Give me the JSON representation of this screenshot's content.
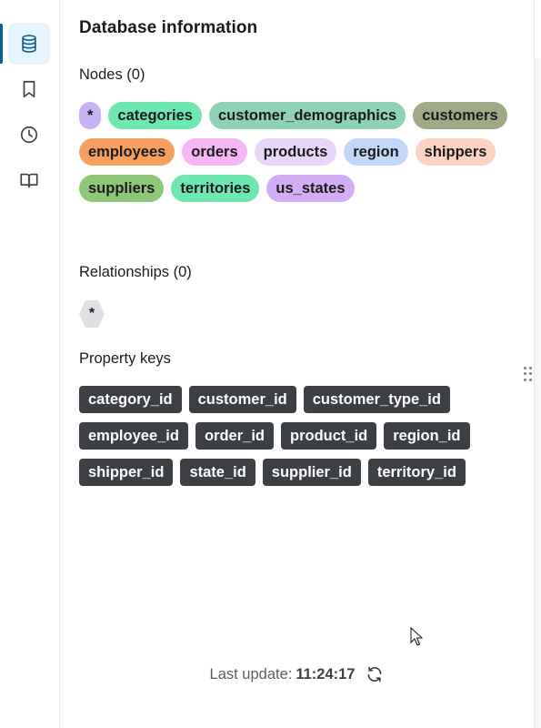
{
  "rail": {
    "items": [
      {
        "icon": "database-icon",
        "active": true
      },
      {
        "icon": "bookmark-icon",
        "active": false
      },
      {
        "icon": "history-clock-icon",
        "active": false
      },
      {
        "icon": "book-open-icon",
        "active": false
      }
    ],
    "accent": "#0a6190"
  },
  "panel": {
    "title": "Database information",
    "nodes": {
      "label": "Nodes (0)",
      "chips": [
        {
          "label": "*",
          "color": "#c8b4f5"
        },
        {
          "label": "categories",
          "color": "#6fe7b0"
        },
        {
          "label": "customer_demographics",
          "color": "#8ed3b5"
        },
        {
          "label": "customers",
          "color": "#a0a986"
        },
        {
          "label": "employees",
          "color": "#f5a05e"
        },
        {
          "label": "orders",
          "color": "#f6b6f5"
        },
        {
          "label": "products",
          "color": "#e7d6f7"
        },
        {
          "label": "region",
          "color": "#c2d7f7"
        },
        {
          "label": "shippers",
          "color": "#fdd2c3"
        },
        {
          "label": "suppliers",
          "color": "#8fc779"
        },
        {
          "label": "territories",
          "color": "#6fe7b0"
        },
        {
          "label": "us_states",
          "color": "#d3aef5"
        }
      ]
    },
    "relationships": {
      "label": "Relationships (0)",
      "chips": [
        {
          "label": "*"
        }
      ]
    },
    "property_keys": {
      "label": "Property keys",
      "keys": [
        "category_id",
        "customer_id",
        "customer_type_id",
        "employee_id",
        "order_id",
        "product_id",
        "region_id",
        "shipper_id",
        "state_id",
        "supplier_id",
        "territory_id"
      ]
    },
    "footer": {
      "prefix": "Last update:",
      "time": "11:24:17",
      "refresh_icon": "refresh-icon"
    }
  }
}
